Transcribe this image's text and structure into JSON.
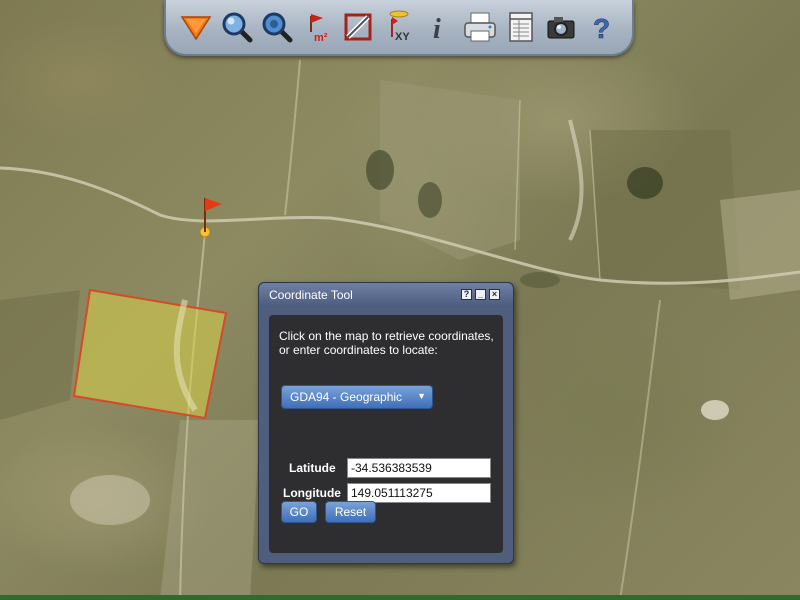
{
  "toolbar": {
    "tools": [
      {
        "name": "layers-icon"
      },
      {
        "name": "zoom-in-icon"
      },
      {
        "name": "zoom-out-icon"
      },
      {
        "name": "measure-area-icon",
        "label": "m²"
      },
      {
        "name": "measure-distance-icon"
      },
      {
        "name": "coordinate-xy-icon",
        "label": "XY"
      },
      {
        "name": "info-icon",
        "label": "i"
      },
      {
        "name": "print-icon"
      },
      {
        "name": "report-icon"
      },
      {
        "name": "camera-icon"
      },
      {
        "name": "help-icon",
        "label": "?"
      }
    ]
  },
  "map": {
    "marker": "flag-marker-icon",
    "selection_color": "#d64a2a",
    "selection_fill": "#d8d24a"
  },
  "dialog": {
    "title": "Coordinate Tool",
    "window_buttons": {
      "help": "?",
      "minimize": "_",
      "close": "×"
    },
    "instructions": "Click on the map to retrieve coordinates, or enter coordinates to locate:",
    "projection_selected": "GDA94 - Geographic",
    "latitude_label": "Latitude",
    "latitude_value": "-34.536383539",
    "longitude_label": "Longitude",
    "longitude_value": "149.051113275",
    "go_label": "GO",
    "reset_label": "Reset"
  },
  "colors": {
    "toolbar_border": "#6d7c8e",
    "dialog_frame": "#4f5e7c",
    "dialog_body": "#2e2e30",
    "button_blue": "#3e6fb8"
  }
}
